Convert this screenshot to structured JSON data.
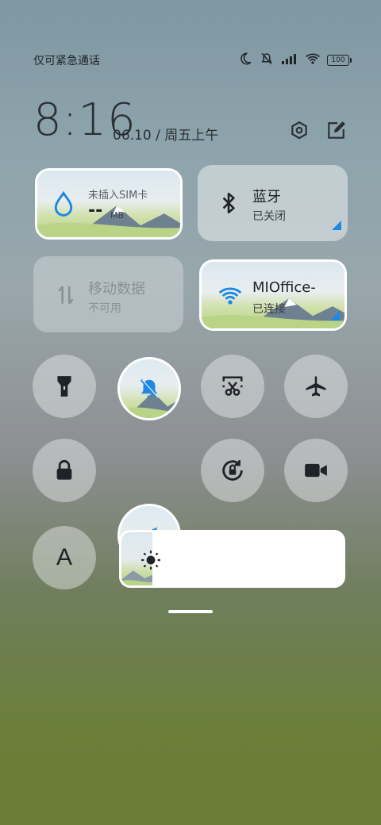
{
  "status": {
    "carrier": "仅可紧急通话",
    "battery": "100"
  },
  "header": {
    "time": "8:16",
    "date": "06.10 / 周五上午"
  },
  "tiles": {
    "sim": {
      "label": "未插入SIM卡",
      "value": "--",
      "unit": "MB"
    },
    "bluetooth": {
      "title": "蓝牙",
      "status": "已关闭"
    },
    "mobile_data": {
      "title": "移动数据",
      "status": "不可用"
    },
    "wifi": {
      "title": "MIOffice-",
      "status": "已连接"
    }
  },
  "font_button": {
    "label": "A"
  },
  "brightness": {
    "level": 0.14
  },
  "colors": {
    "accent": "#1e88e5",
    "tile_bg": "rgba(235,238,240,0.55)",
    "text": "#1f2328"
  }
}
